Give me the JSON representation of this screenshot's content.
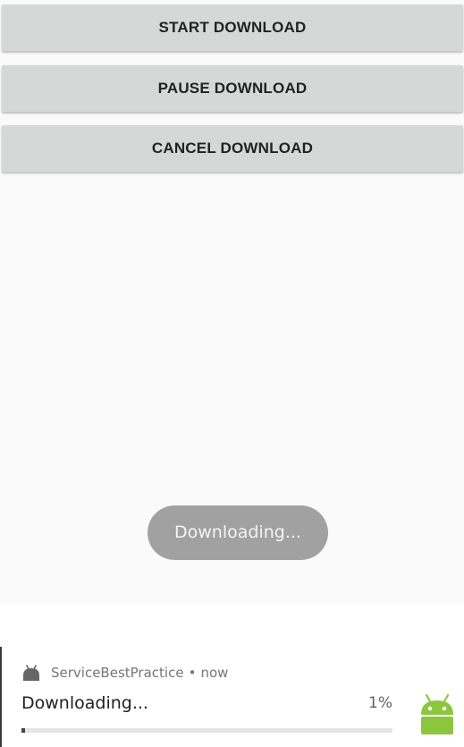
{
  "buttons": {
    "start": "START DOWNLOAD",
    "pause": "PAUSE DOWNLOAD",
    "cancel": "CANCEL DOWNLOAD"
  },
  "toast": {
    "text": "Downloading..."
  },
  "notification": {
    "app_icon": "android-head-icon",
    "app_name": "ServiceBestPractice",
    "separator": "•",
    "time": "now",
    "title": "Downloading...",
    "progress_text": "1%",
    "progress_fraction": 0.01,
    "large_icon": "android-robot-icon",
    "accent_color": "#8cc63f"
  }
}
